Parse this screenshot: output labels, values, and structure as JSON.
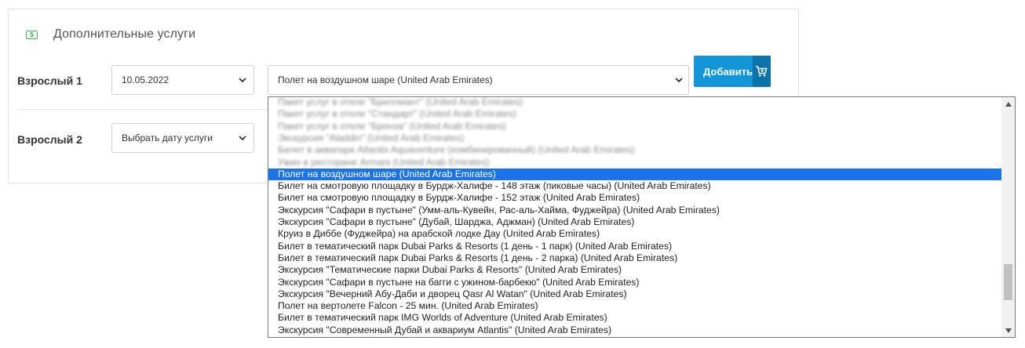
{
  "section": {
    "icon": "money-icon",
    "icon_symbol": "S",
    "title": "Дополнительные услуги"
  },
  "rows": [
    {
      "label": "Взрослый 1",
      "date_value": "10.05.2022",
      "service_value": "Полет на воздушном шаре (United Arab Emirates)"
    },
    {
      "label": "Взрослый 2",
      "date_value": "Выбрать дату услуги"
    }
  ],
  "add_button": {
    "label": "Добавить",
    "icon": "cart-icon"
  },
  "dropdown_options": [
    "Пакет услуг в отеле \"Бриллиант\" (United Arab Emirates)",
    "Пакет услуг в отеле \"Стандарт\" (United Arab Emirates)",
    "Пакет услуг в отеле \"Бронза\" (United Arab Emirates)",
    "Экскурсия \"Aladdin\" (United Arab Emirates)",
    "Билет в аквапарк Atlantis Aquaventure (комбинированный) (United Arab Emirates)",
    "Ужин в ресторане Armani (United Arab Emirates)",
    "Полет на воздушном шаре (United Arab Emirates)",
    "Билет на смотровую площадку в Бурдж-Халифе - 148 этаж (пиковые часы) (United Arab Emirates)",
    "Билет на смотровую площадку в Бурдж-Халифе - 152 этаж (United Arab Emirates)",
    "Экскурсия \"Сафари в пустыне\" (Умм-аль-Кувейн, Рас-аль-Хайма, Фуджейра) (United Arab Emirates)",
    "Экскурсия \"Сафари в пустыне\" (Дубай, Шарджа, Аджман) (United Arab Emirates)",
    "Круиз в Диббе (Фуджейра) на арабской лодке Дау (United Arab Emirates)",
    "Билет в тематический парк Dubai Parks & Resorts (1 день - 1 парк) (United Arab Emirates)",
    "Билет в тематический парк Dubai Parks & Resorts (1 день - 2 парка) (United Arab Emirates)",
    "Экскурсия \"Тематические парки Dubai Parks & Resorts\" (United Arab Emirates)",
    "Экскурсия \"Сафари в пустыне на багги с ужином-барбекю\" (United Arab Emirates)",
    "Экскурсия \"Вечерний Абу-Даби и дворец Qasr Al Watan\" (United Arab Emirates)",
    "Полет на вертолете Falcon - 25 мин. (United Arab Emirates)",
    "Билет в тематический парк IMG Worlds of Adventure (United Arab Emirates)",
    "Экскурсия \"Современный Дубай и аквариум Atlantis\" (United Arab Emirates)"
  ],
  "selected_index": 6,
  "blurred_count": 6,
  "colors": {
    "accent": "#1296d8",
    "accent_dark": "#0a73a9",
    "selection": "#1a73e8",
    "icon_green": "#39b54a"
  }
}
